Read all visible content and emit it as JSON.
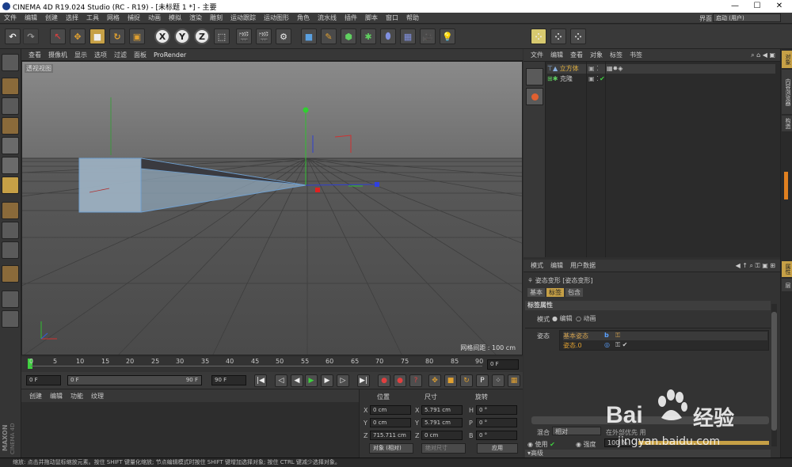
{
  "window": {
    "title": "CINEMA 4D R19.024 Studio (RC - R19) - [未标题 1 *] - 主要",
    "minimize": "—",
    "maximize": "☐",
    "close": "✕"
  },
  "menubar": {
    "items": [
      "文件",
      "编辑",
      "创建",
      "选择",
      "工具",
      "网格",
      "捕捉",
      "动画",
      "模拟",
      "渲染",
      "雕刻",
      "运动跟踪",
      "运动图形",
      "角色",
      "流水线",
      "插件",
      "脚本",
      "窗口",
      "帮助"
    ],
    "layout_label": "界面:",
    "layout_value": "启动 (用户)"
  },
  "toolbar": {
    "x": "X",
    "y": "Y",
    "z": "Z"
  },
  "viewport": {
    "menu": [
      "查看",
      "摄像机",
      "显示",
      "选项",
      "过滤",
      "面板"
    ],
    "prorender": "ProRender",
    "label": "透视视图",
    "grid_spacing": "网格间距 : 100 cm"
  },
  "timeline": {
    "ticks": [
      "0",
      "5",
      "10",
      "15",
      "20",
      "25",
      "30",
      "35",
      "40",
      "45",
      "50",
      "55",
      "60",
      "65",
      "70",
      "75",
      "80",
      "85",
      "90"
    ],
    "current_frame": "0 F"
  },
  "transport": {
    "start": "0 F",
    "slider_start": "0 F",
    "slider_end": "90 F",
    "end": "90 F"
  },
  "material_manager": {
    "menu": [
      "创建",
      "编辑",
      "功能",
      "纹理"
    ],
    "brand": "MAXON",
    "brand2": "CINEMA 4D"
  },
  "coordinates": {
    "headers": {
      "position": "位置",
      "size": "尺寸",
      "rotation": "旋转"
    },
    "rows": [
      {
        "axis": "X",
        "pos": "0 cm",
        "size_axis": "X",
        "size": "5.791 cm",
        "rot_axis": "H",
        "rot": "0 °"
      },
      {
        "axis": "Y",
        "pos": "0 cm",
        "size_axis": "Y",
        "size": "5.791 cm",
        "rot_axis": "P",
        "rot": "0 °"
      },
      {
        "axis": "Z",
        "pos": "715.711 cm",
        "size_axis": "Z",
        "size": "0 cm",
        "rot_axis": "B",
        "rot": "0 °"
      }
    ],
    "mode": "对象 (相对)",
    "size_mode": "绝对尺寸",
    "apply": "应用"
  },
  "object_manager": {
    "menu": [
      "文件",
      "编辑",
      "查看",
      "对象",
      "标签",
      "书签"
    ],
    "objects": [
      {
        "name": "立方体",
        "color": "#e0b040"
      },
      {
        "name": "克隆",
        "color": "#c8c8c8"
      }
    ]
  },
  "attribute_manager": {
    "menu": [
      "模式",
      "编辑",
      "用户数据"
    ],
    "header": "姿态变形 [姿态变形]",
    "tabs": [
      "基本",
      "标签",
      "包含"
    ],
    "section": "标签属性",
    "mode_label": "模式",
    "mode_options": [
      "编辑",
      "动画"
    ],
    "pose_label": "姿态",
    "pose_items": [
      "基本姿态",
      "姿态.0"
    ],
    "blend_label": "混合",
    "blend_value": "相对",
    "use_label": "使用",
    "strength_label": "强度",
    "strength_value": "100 %",
    "footer": "▾高级",
    "extra": "在外部优先 用"
  },
  "right_tabs": [
    "对象",
    "内容浏览器",
    "构造",
    "属性",
    "层"
  ],
  "status": "缩放: 点击并拖动鼠标缩放元素。按住 SHIFT 键量化缩放; 节点编辑模式时按住 SHIFT 键增加选择对象; 按住 CTRL 键减少选择对象。",
  "watermark": {
    "brand": "Bai",
    "brand_cn": "经验",
    "url": "jingyan.baidu.com"
  },
  "colors": {
    "accent": "#c6a046",
    "axis_x": "#d03030",
    "axis_y": "#30c030",
    "axis_z": "#3040d0"
  }
}
